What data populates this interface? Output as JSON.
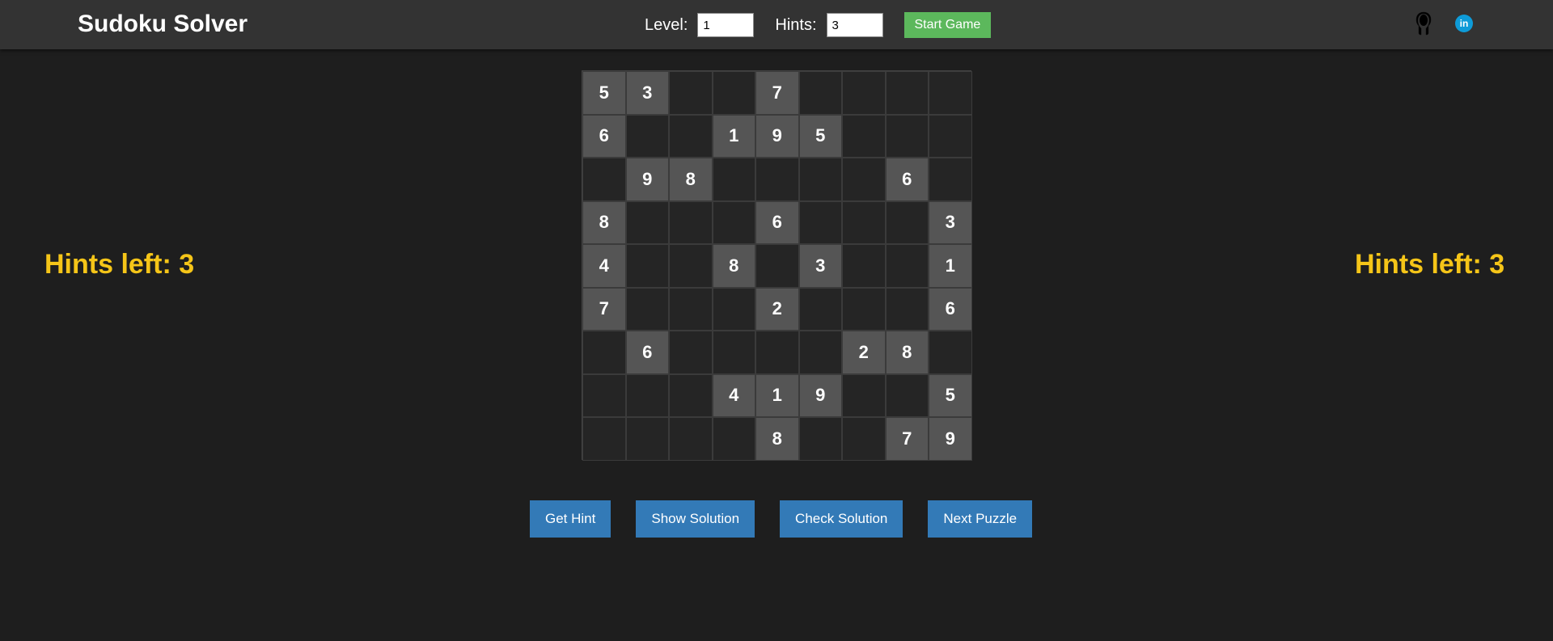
{
  "header": {
    "title": "Sudoku Solver",
    "level_label": "Level:",
    "level_value": "1",
    "hints_label": "Hints:",
    "hints_value": "3",
    "start_label": "Start Game",
    "linkedin_text": "in"
  },
  "hints_left_text": "Hints left: 3",
  "board": [
    [
      "5",
      "3",
      "",
      "",
      "7",
      "",
      "",
      "",
      ""
    ],
    [
      "6",
      "",
      "",
      "1",
      "9",
      "5",
      "",
      "",
      ""
    ],
    [
      "",
      "9",
      "8",
      "",
      "",
      "",
      "",
      "6",
      ""
    ],
    [
      "8",
      "",
      "",
      "",
      "6",
      "",
      "",
      "",
      "3"
    ],
    [
      "4",
      "",
      "",
      "8",
      "",
      "3",
      "",
      "",
      "1"
    ],
    [
      "7",
      "",
      "",
      "",
      "2",
      "",
      "",
      "",
      "6"
    ],
    [
      "",
      "6",
      "",
      "",
      "",
      "",
      "2",
      "8",
      ""
    ],
    [
      "",
      "",
      "",
      "4",
      "1",
      "9",
      "",
      "",
      "5"
    ],
    [
      "",
      "",
      "",
      "",
      "8",
      "",
      "",
      "7",
      "9"
    ]
  ],
  "actions": {
    "get_hint": "Get Hint",
    "show_solution": "Show Solution",
    "check_solution": "Check Solution",
    "next_puzzle": "Next Puzzle"
  },
  "colors": {
    "background": "#1e1e1e",
    "topbar": "#333333",
    "accent_yellow": "#f5c518",
    "start_green": "#5cb85c",
    "action_blue": "#337ab7",
    "given_cell": "#555555",
    "empty_cell": "#252525"
  },
  "icons": {
    "github": "github-icon",
    "linkedin": "linkedin-icon"
  }
}
